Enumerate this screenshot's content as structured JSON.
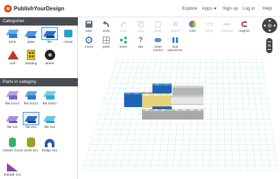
{
  "brand": {
    "name": "PublishYourDesign"
  },
  "nav": [
    {
      "label": "Explore"
    },
    {
      "label": "Apps"
    },
    {
      "label": "Sign up"
    },
    {
      "label": "Log in"
    },
    {
      "label": "Help"
    }
  ],
  "sidebar": {
    "categories_title": "Categories",
    "categories": [
      {
        "label": "brick",
        "color": "#3b8de0",
        "icon": "brick-icon"
      },
      {
        "label": "plate",
        "color": "#2b79c9",
        "icon": "plate-icon"
      },
      {
        "label": "tile",
        "color": "#1f5ea8",
        "icon": "tile-icon"
      },
      {
        "label": "corner",
        "color": "#1fa3c7",
        "icon": "corner-icon"
      },
      {
        "label": "roof",
        "color": "#c0392b",
        "icon": "roof-icon"
      },
      {
        "label": "building",
        "color": "#e0c33a",
        "icon": "building-icon"
      },
      {
        "label": "wheel",
        "color": "#222222",
        "icon": "wheel-icon"
      }
    ],
    "parts_title": "Parts in category",
    "parts": [
      {
        "label": "flat 1x1x1",
        "color": "#8e6fd6"
      },
      {
        "label": "flat 2x1x1",
        "color": "#2f86d8"
      },
      {
        "label": "flat 2x2x1",
        "color": "#38b9d6"
      },
      {
        "label": "flat 1x1",
        "color": "#7f5fd0"
      },
      {
        "label": "flat 2x1",
        "color": "#2b79c9"
      },
      {
        "label": "flat 2x2",
        "color": "#2fb0d2"
      },
      {
        "label": "cilinder 1x1x2",
        "color": "#2fb36b"
      },
      {
        "label": "circle 2x1",
        "color": "#9aa124"
      },
      {
        "label": "bridge 2x1",
        "color": "#1f5ea8"
      },
      {
        "label": "triangle 1x1",
        "color": "#7d2a9c"
      }
    ]
  },
  "toolbar": {
    "row1": [
      {
        "label": "save",
        "icon": "save-icon",
        "enabled": true
      },
      {
        "label": "undo",
        "icon": "undo-icon",
        "enabled": true
      },
      {
        "label": "redo",
        "icon": "redo-icon",
        "enabled": false
      },
      {
        "label": "copy",
        "icon": "copy-icon",
        "enabled": false
      },
      {
        "label": "paste",
        "icon": "paste-icon",
        "enabled": false
      },
      {
        "label": "delete",
        "icon": "delete-icon",
        "enabled": false
      },
      {
        "label": "color",
        "icon": "color-icon",
        "enabled": true
      },
      {
        "label": "hinge",
        "icon": "hinge-icon",
        "enabled": false
      },
      {
        "label": "translate",
        "icon": "translate-icon",
        "enabled": false
      },
      {
        "label": "magnet",
        "icon": "magnet-icon",
        "enabled": true
      }
    ],
    "row2": [
      {
        "label": "movie",
        "icon": "movie-icon"
      },
      {
        "label": "grids",
        "icon": "grid-icon"
      },
      {
        "label": "share",
        "icon": "share-icon"
      },
      {
        "label": "tips",
        "icon": "help-icon"
      },
      {
        "label": "rotate current",
        "icon": "rotate-icon"
      },
      {
        "label": "stop placement",
        "icon": "stop-icon"
      }
    ]
  },
  "colors": {
    "blue_brick": "#1f63b3",
    "yellow_brick": "#e6d37a",
    "gray_brick": "#a8a8a8",
    "grid_line": "#c9ecf2"
  }
}
